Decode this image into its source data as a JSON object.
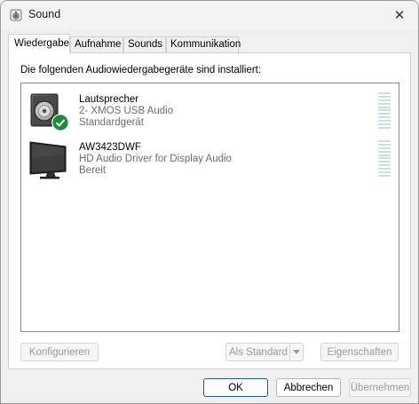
{
  "window": {
    "title": "Sound",
    "close_glyph": "✕"
  },
  "tabs": [
    {
      "label": "Wiedergabe",
      "active": true
    },
    {
      "label": "Aufnahme",
      "active": false
    },
    {
      "label": "Sounds",
      "active": false
    },
    {
      "label": "Kommunikation",
      "active": false
    }
  ],
  "panel": {
    "caption": "Die folgenden Audiowiedergabegeräte sind installiert:",
    "devices": [
      {
        "name": "Lautsprecher",
        "description": "2- XMOS USB Audio",
        "status": "Standardgerät",
        "icon": "speaker-icon",
        "default": true
      },
      {
        "name": "AW3423DWF",
        "description": "HD Audio Driver for Display Audio",
        "status": "Bereit",
        "icon": "monitor-icon",
        "default": false
      }
    ]
  },
  "buttons": {
    "configure": "Konfigurieren",
    "set_default": "Als Standard",
    "properties": "Eigenschaften",
    "ok": "OK",
    "cancel": "Abbrechen",
    "apply": "Übernehmen"
  },
  "colors": {
    "accent": "#005fb8",
    "check_green": "#1e8b3c",
    "meter_idle": "#c9dfe6"
  }
}
